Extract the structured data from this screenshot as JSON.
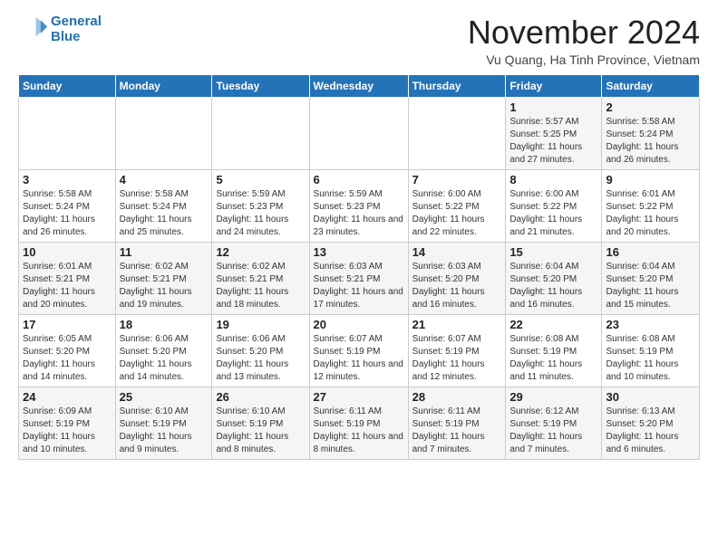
{
  "header": {
    "logo_line1": "General",
    "logo_line2": "Blue",
    "month_title": "November 2024",
    "location": "Vu Quang, Ha Tinh Province, Vietnam"
  },
  "weekdays": [
    "Sunday",
    "Monday",
    "Tuesday",
    "Wednesday",
    "Thursday",
    "Friday",
    "Saturday"
  ],
  "weeks": [
    [
      {
        "day": "",
        "info": ""
      },
      {
        "day": "",
        "info": ""
      },
      {
        "day": "",
        "info": ""
      },
      {
        "day": "",
        "info": ""
      },
      {
        "day": "",
        "info": ""
      },
      {
        "day": "1",
        "info": "Sunrise: 5:57 AM\nSunset: 5:25 PM\nDaylight: 11 hours and 27 minutes."
      },
      {
        "day": "2",
        "info": "Sunrise: 5:58 AM\nSunset: 5:24 PM\nDaylight: 11 hours and 26 minutes."
      }
    ],
    [
      {
        "day": "3",
        "info": "Sunrise: 5:58 AM\nSunset: 5:24 PM\nDaylight: 11 hours and 26 minutes."
      },
      {
        "day": "4",
        "info": "Sunrise: 5:58 AM\nSunset: 5:24 PM\nDaylight: 11 hours and 25 minutes."
      },
      {
        "day": "5",
        "info": "Sunrise: 5:59 AM\nSunset: 5:23 PM\nDaylight: 11 hours and 24 minutes."
      },
      {
        "day": "6",
        "info": "Sunrise: 5:59 AM\nSunset: 5:23 PM\nDaylight: 11 hours and 23 minutes."
      },
      {
        "day": "7",
        "info": "Sunrise: 6:00 AM\nSunset: 5:22 PM\nDaylight: 11 hours and 22 minutes."
      },
      {
        "day": "8",
        "info": "Sunrise: 6:00 AM\nSunset: 5:22 PM\nDaylight: 11 hours and 21 minutes."
      },
      {
        "day": "9",
        "info": "Sunrise: 6:01 AM\nSunset: 5:22 PM\nDaylight: 11 hours and 20 minutes."
      }
    ],
    [
      {
        "day": "10",
        "info": "Sunrise: 6:01 AM\nSunset: 5:21 PM\nDaylight: 11 hours and 20 minutes."
      },
      {
        "day": "11",
        "info": "Sunrise: 6:02 AM\nSunset: 5:21 PM\nDaylight: 11 hours and 19 minutes."
      },
      {
        "day": "12",
        "info": "Sunrise: 6:02 AM\nSunset: 5:21 PM\nDaylight: 11 hours and 18 minutes."
      },
      {
        "day": "13",
        "info": "Sunrise: 6:03 AM\nSunset: 5:21 PM\nDaylight: 11 hours and 17 minutes."
      },
      {
        "day": "14",
        "info": "Sunrise: 6:03 AM\nSunset: 5:20 PM\nDaylight: 11 hours and 16 minutes."
      },
      {
        "day": "15",
        "info": "Sunrise: 6:04 AM\nSunset: 5:20 PM\nDaylight: 11 hours and 16 minutes."
      },
      {
        "day": "16",
        "info": "Sunrise: 6:04 AM\nSunset: 5:20 PM\nDaylight: 11 hours and 15 minutes."
      }
    ],
    [
      {
        "day": "17",
        "info": "Sunrise: 6:05 AM\nSunset: 5:20 PM\nDaylight: 11 hours and 14 minutes."
      },
      {
        "day": "18",
        "info": "Sunrise: 6:06 AM\nSunset: 5:20 PM\nDaylight: 11 hours and 14 minutes."
      },
      {
        "day": "19",
        "info": "Sunrise: 6:06 AM\nSunset: 5:20 PM\nDaylight: 11 hours and 13 minutes."
      },
      {
        "day": "20",
        "info": "Sunrise: 6:07 AM\nSunset: 5:19 PM\nDaylight: 11 hours and 12 minutes."
      },
      {
        "day": "21",
        "info": "Sunrise: 6:07 AM\nSunset: 5:19 PM\nDaylight: 11 hours and 12 minutes."
      },
      {
        "day": "22",
        "info": "Sunrise: 6:08 AM\nSunset: 5:19 PM\nDaylight: 11 hours and 11 minutes."
      },
      {
        "day": "23",
        "info": "Sunrise: 6:08 AM\nSunset: 5:19 PM\nDaylight: 11 hours and 10 minutes."
      }
    ],
    [
      {
        "day": "24",
        "info": "Sunrise: 6:09 AM\nSunset: 5:19 PM\nDaylight: 11 hours and 10 minutes."
      },
      {
        "day": "25",
        "info": "Sunrise: 6:10 AM\nSunset: 5:19 PM\nDaylight: 11 hours and 9 minutes."
      },
      {
        "day": "26",
        "info": "Sunrise: 6:10 AM\nSunset: 5:19 PM\nDaylight: 11 hours and 8 minutes."
      },
      {
        "day": "27",
        "info": "Sunrise: 6:11 AM\nSunset: 5:19 PM\nDaylight: 11 hours and 8 minutes."
      },
      {
        "day": "28",
        "info": "Sunrise: 6:11 AM\nSunset: 5:19 PM\nDaylight: 11 hours and 7 minutes."
      },
      {
        "day": "29",
        "info": "Sunrise: 6:12 AM\nSunset: 5:19 PM\nDaylight: 11 hours and 7 minutes."
      },
      {
        "day": "30",
        "info": "Sunrise: 6:13 AM\nSunset: 5:20 PM\nDaylight: 11 hours and 6 minutes."
      }
    ]
  ]
}
